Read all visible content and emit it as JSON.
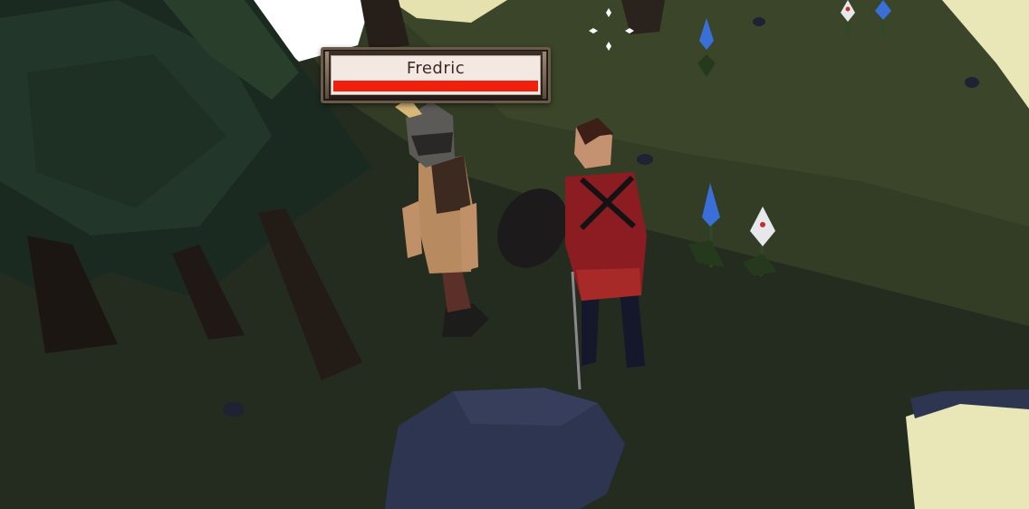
{
  "npc": {
    "name": "Fredric",
    "health_fraction": 1.0
  },
  "colors": {
    "health_fill": "#f0200f",
    "plate_frame": "#6b5a4a",
    "plate_background": "#f4e9e2",
    "grass_dark": "#232c1e",
    "grass_light": "#3f4b2b",
    "sunlit": "#e9e6b8"
  },
  "icons": {
    "crosshair": "crosshair-icon"
  }
}
